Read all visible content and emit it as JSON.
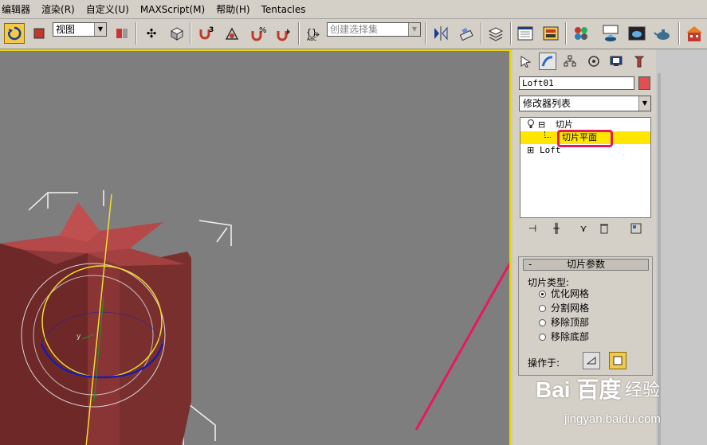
{
  "menubar": [
    "编辑器",
    "渲染(R)",
    "自定义(U)",
    "MAXScript(M)",
    "帮助(H)",
    "Tentacles"
  ],
  "toolbar": {
    "view_dropdown": "视图",
    "selection_set": "创建选择集",
    "snap_label": "3",
    "icons": [
      "select-rotate-icon",
      "select-region-icon",
      "mirror-icon",
      "align-icon",
      "layer-icon",
      "curve-editor-icon",
      "schematic-icon",
      "material-editor-icon",
      "render-setup-icon",
      "render-frame-icon",
      "teapot-render-icon"
    ]
  },
  "viewport": {
    "axis_label": "y"
  },
  "panel": {
    "tabs": [
      "create-tab",
      "modify-tab",
      "hierarchy-tab",
      "motion-tab",
      "display-tab",
      "utilities-tab"
    ],
    "object_name": "Loft01",
    "object_color": "#e05050",
    "modifier_list": "修改器列表",
    "stack": [
      {
        "label": "切片",
        "expand": "⊟"
      },
      {
        "label": "切片平面"
      },
      {
        "label": "Loft",
        "expand": "⊞"
      }
    ],
    "rollout": {
      "title": "切片参数",
      "slice_type_label": "切片类型:",
      "options": [
        "优化网格",
        "分割网格",
        "移除顶部",
        "移除底部"
      ],
      "selected": 0,
      "operate_on_label": "操作于:"
    }
  },
  "watermark": {
    "logo": "Bai 百度",
    "name": "经验",
    "url": "jingyan.baidu.com"
  }
}
